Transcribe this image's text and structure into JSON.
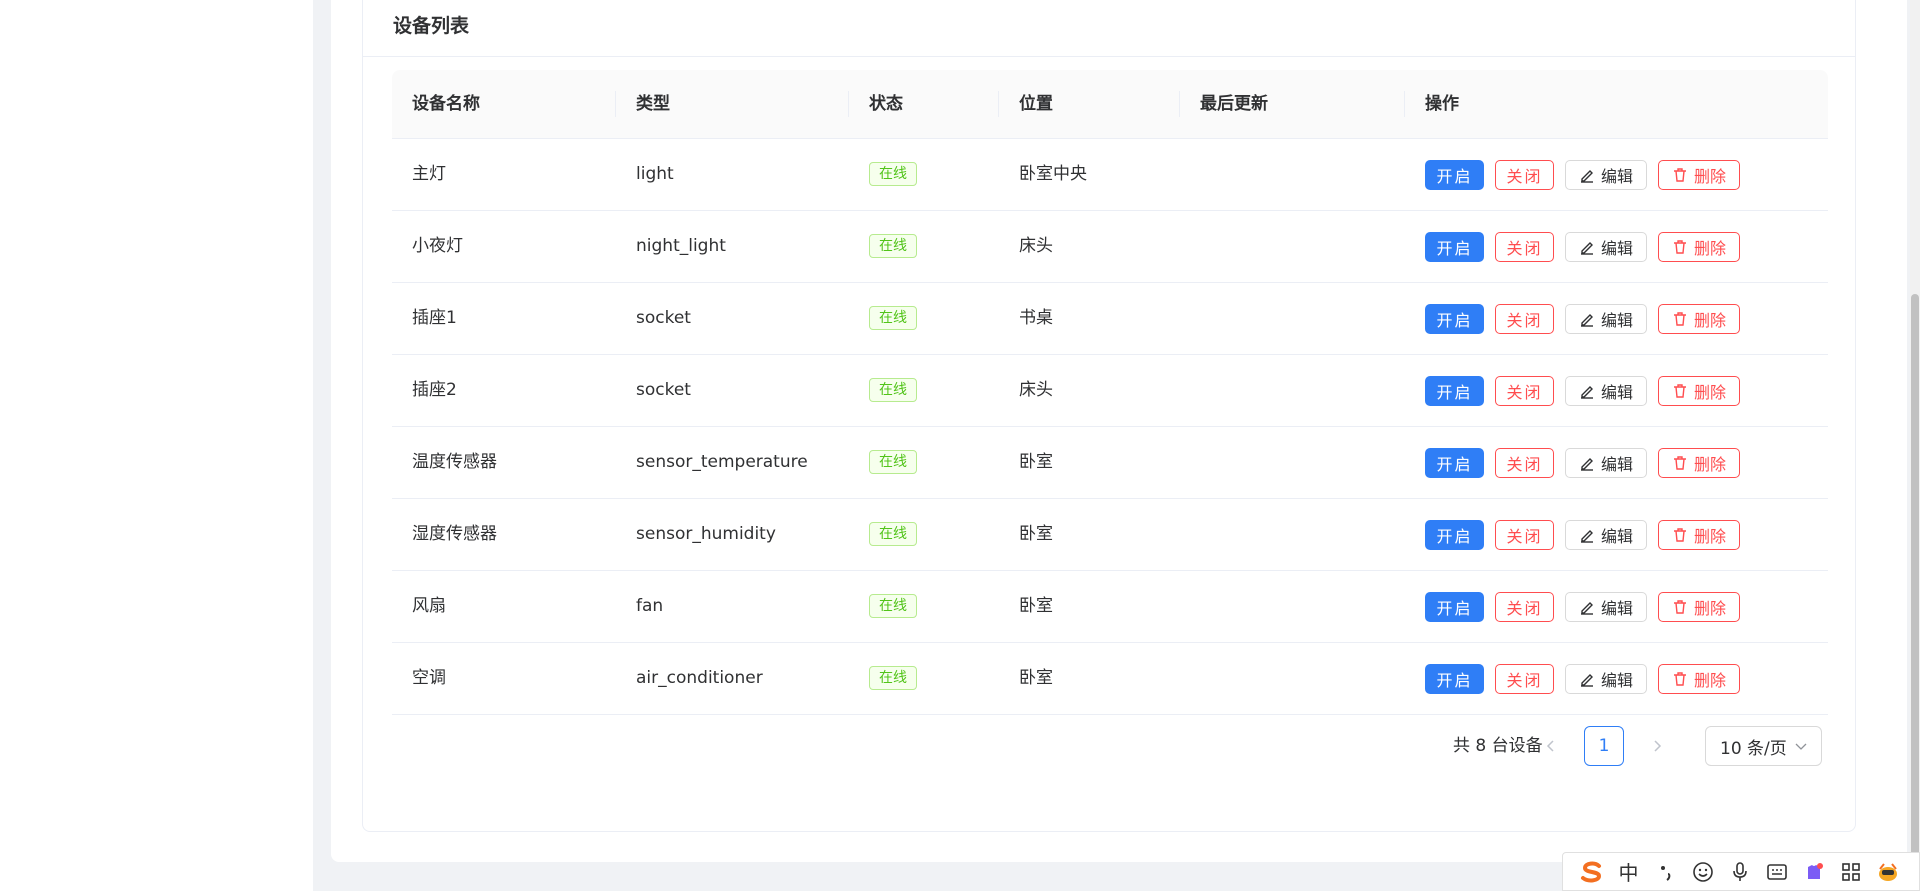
{
  "card": {
    "title": "设备列表"
  },
  "table": {
    "headers": {
      "name": "设备名称",
      "type": "类型",
      "status": "状态",
      "location": "位置",
      "updated": "最后更新",
      "actions": "操作"
    },
    "rows": [
      {
        "name": "主灯",
        "type": "light",
        "status": "在线",
        "location": "卧室中央",
        "updated": ""
      },
      {
        "name": "小夜灯",
        "type": "night_light",
        "status": "在线",
        "location": "床头",
        "updated": ""
      },
      {
        "name": "插座1",
        "type": "socket",
        "status": "在线",
        "location": "书桌",
        "updated": ""
      },
      {
        "name": "插座2",
        "type": "socket",
        "status": "在线",
        "location": "床头",
        "updated": ""
      },
      {
        "name": "温度传感器",
        "type": "sensor_temperature",
        "status": "在线",
        "location": "卧室",
        "updated": ""
      },
      {
        "name": "湿度传感器",
        "type": "sensor_humidity",
        "status": "在线",
        "location": "卧室",
        "updated": ""
      },
      {
        "name": "风扇",
        "type": "fan",
        "status": "在线",
        "location": "卧室",
        "updated": ""
      },
      {
        "name": "空调",
        "type": "air_conditioner",
        "status": "在线",
        "location": "卧室",
        "updated": ""
      }
    ],
    "actions": {
      "open": "开启",
      "close": "关闭",
      "edit": "编辑",
      "delete": "删除"
    }
  },
  "pagination": {
    "total": "共 8 台设备",
    "current_page": "1",
    "page_size": "10 条/页"
  },
  "ime_toolbar": {
    "items": [
      "sogou-logo-icon",
      "中",
      "punctuation-icon",
      "emoji-icon",
      "microphone-icon",
      "keyboard-icon",
      "skin-icon",
      "toolbox-icon",
      "mascot-icon"
    ],
    "lang_label": "中"
  },
  "colors": {
    "primary": "#2f7ef6",
    "danger": "#ff4d4f",
    "success": "#52c41a",
    "border": "#ebeef5"
  }
}
